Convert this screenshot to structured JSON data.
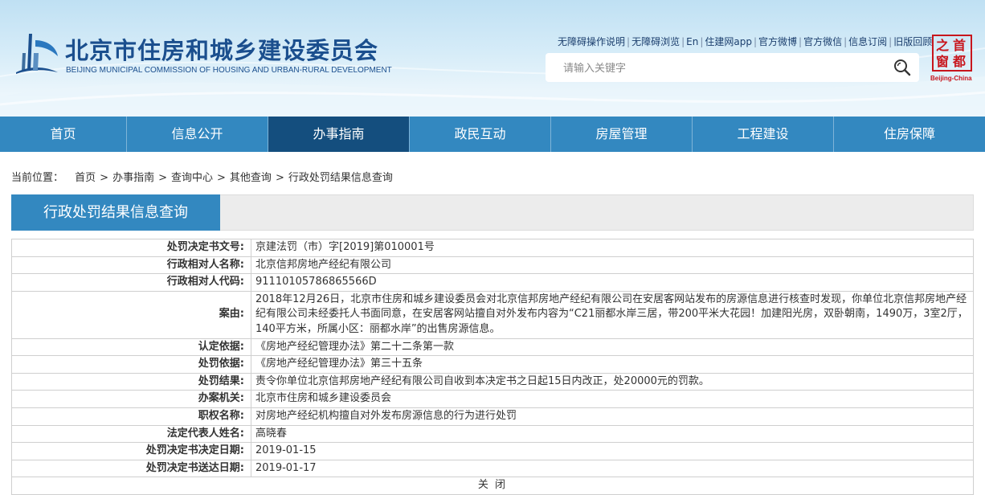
{
  "header": {
    "title": "北京市住房和城乡建设委员会",
    "subtitle": "BEIJING MUNICIPAL COMMISSION OF HOUSING AND URBAN-RURAL DEVELOPMENT",
    "top_links": [
      "无障碍操作说明",
      "无障碍浏览",
      "En",
      "住建网app",
      "官方微博",
      "官方微信",
      "信息订阅",
      "旧版回顾"
    ],
    "search_placeholder": "请输入关键字",
    "seal_chars": [
      "首",
      "都",
      "之",
      "窗"
    ],
    "seal_caption": "Beijing-China",
    "colors": {
      "brand_blue": "#1b4f8e",
      "nav_blue": "#3388c0",
      "nav_active": "#144e7e",
      "seal_red": "#c8161d"
    }
  },
  "nav": {
    "items": [
      "首页",
      "信息公开",
      "办事指南",
      "政民互动",
      "房屋管理",
      "工程建设",
      "住房保障"
    ],
    "active": "办事指南"
  },
  "breadcrumb": {
    "lead": "当前位置：",
    "items": [
      "首页",
      "办事指南",
      "查询中心",
      "其他查询",
      "行政处罚结果信息查询"
    ]
  },
  "section_title": "行政处罚结果信息查询",
  "details": [
    {
      "label": "处罚决定书文号:",
      "value": "京建法罚（市）字[2019]第010001号"
    },
    {
      "label": "行政相对人名称:",
      "value": "北京信邦房地产经纪有限公司"
    },
    {
      "label": "行政相对人代码:",
      "value": "91110105786865566D"
    },
    {
      "label": "案由:",
      "value": "2018年12月26日，北京市住房和城乡建设委员会对北京信邦房地产经纪有限公司在安居客网站发布的房源信息进行核查时发现，你单位北京信邦房地产经纪有限公司未经委托人书面同意，在安居客网站擅自对外发布内容为“C21丽都水岸三居，带200平米大花园！加建阳光房，双卧朝南，1490万，3室2厅，140平方米，所属小区：丽都水岸”的出售房源信息。"
    },
    {
      "label": "认定依据:",
      "value": "《房地产经纪管理办法》第二十二条第一款"
    },
    {
      "label": "处罚依据:",
      "value": "《房地产经纪管理办法》第三十五条"
    },
    {
      "label": "处罚结果:",
      "value": "责令你单位北京信邦房地产经纪有限公司自收到本决定书之日起15日内改正，处20000元的罚款。"
    },
    {
      "label": "办案机关:",
      "value": "北京市住房和城乡建设委员会"
    },
    {
      "label": "职权名称:",
      "value": "对房地产经纪机构擅自对外发布房源信息的行为进行处罚"
    },
    {
      "label": "法定代表人姓名:",
      "value": "高晓春"
    },
    {
      "label": "处罚决定书决定日期:",
      "value": "2019-01-15"
    },
    {
      "label": "处罚决定书送达日期:",
      "value": "2019-01-17"
    }
  ],
  "close_label": "关 闭"
}
